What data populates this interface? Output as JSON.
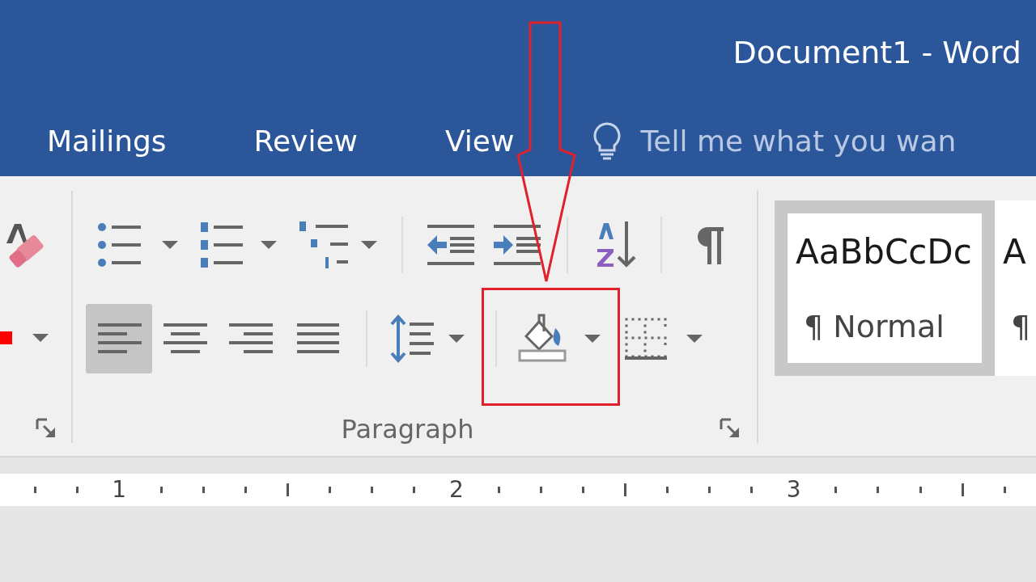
{
  "window": {
    "title": "Document1 - Word"
  },
  "tabs": [
    {
      "label": "Mailings",
      "selected": false
    },
    {
      "label": "Review",
      "selected": false
    },
    {
      "label": "View",
      "selected": false
    }
  ],
  "tell_me": {
    "placeholder": "Tell me what you wan"
  },
  "paragraph": {
    "label": "Paragraph",
    "alignments": [
      {
        "kind": "left",
        "selected": true
      },
      {
        "kind": "center",
        "selected": false
      },
      {
        "kind": "right",
        "selected": false
      },
      {
        "kind": "justify",
        "selected": false
      }
    ]
  },
  "styles": [
    {
      "preview": "AaBbCcDc",
      "name": "¶ Normal",
      "selected": true
    },
    {
      "preview": "A",
      "name": "¶",
      "selected": false
    }
  ],
  "ruler": {
    "numbers": [
      "1",
      "2",
      "3"
    ]
  }
}
